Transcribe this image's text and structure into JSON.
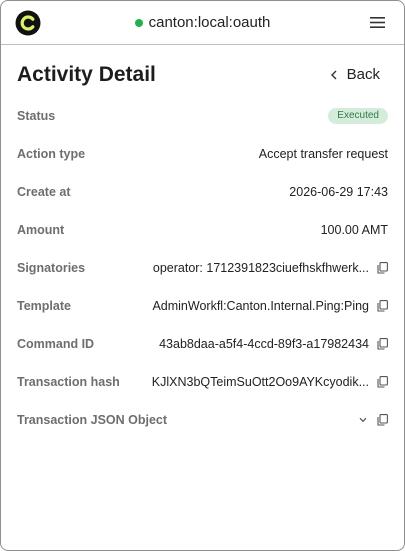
{
  "header": {
    "network": "canton:local:oauth"
  },
  "page": {
    "title": "Activity Detail",
    "back_label": "Back"
  },
  "fields": {
    "status": {
      "label": "Status",
      "value": "Executed"
    },
    "action_type": {
      "label": "Action type",
      "value": "Accept transfer request"
    },
    "create_at": {
      "label": "Create at",
      "value": "2026-06-29 17:43"
    },
    "amount": {
      "label": "Amount",
      "value": "100.00 AMT"
    },
    "signatories": {
      "label": "Signatories",
      "value": "operator: 1712391823ciuefhskfhwerk..."
    },
    "template": {
      "label": "Template",
      "value": "AdminWorkfl:Canton.Internal.Ping:Ping"
    },
    "command_id": {
      "label": "Command ID",
      "value": "43ab8daa-a5f4-4ccd-89f3-a17982434"
    },
    "transaction_hash": {
      "label": "Transaction hash",
      "value": "KJlXN3bQTeimSuOtt2Oo9AYKcyodik..."
    },
    "transaction_json": {
      "label": "Transaction JSON Object"
    }
  },
  "colors": {
    "status_bg": "#d6ecdb",
    "status_text": "#2f7a44",
    "online_dot": "#22b14c"
  },
  "icons": [
    "canton-logo-icon",
    "menu-icon",
    "chevron-left-icon",
    "copy-icon",
    "chevron-down-icon"
  ]
}
